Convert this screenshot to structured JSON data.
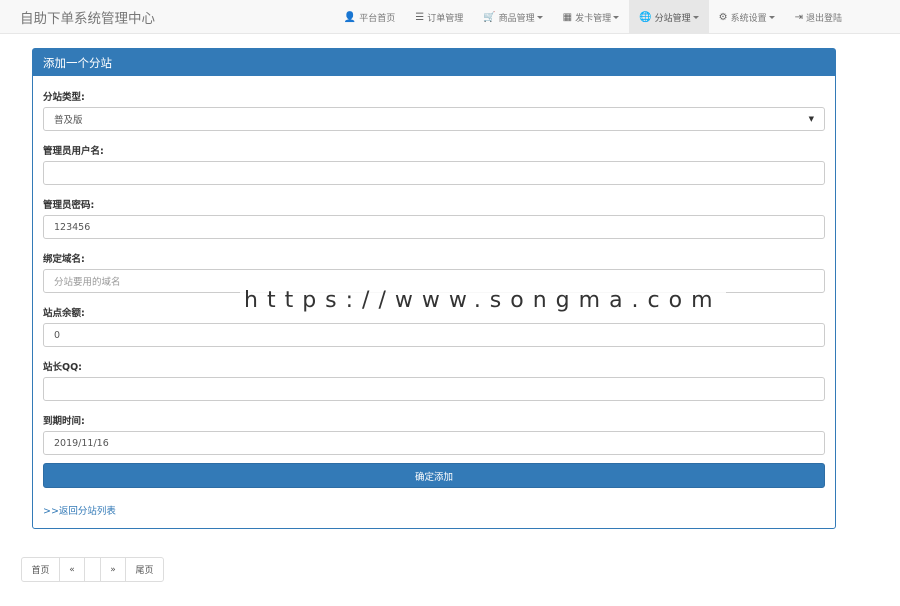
{
  "navbar": {
    "brand": "自助下单系统管理中心",
    "items": [
      {
        "label": "平台首页",
        "icon": "user-icon",
        "glyph": "👤",
        "dropdown": false,
        "active": false
      },
      {
        "label": "订单管理",
        "icon": "list-icon",
        "glyph": "☰",
        "dropdown": false,
        "active": false
      },
      {
        "label": "商品管理",
        "icon": "cart-icon",
        "glyph": "🛒",
        "dropdown": true,
        "active": false
      },
      {
        "label": "发卡管理",
        "icon": "grid-icon",
        "glyph": "▦",
        "dropdown": true,
        "active": false
      },
      {
        "label": "分站管理",
        "icon": "globe-icon",
        "glyph": "🌐",
        "dropdown": true,
        "active": true
      },
      {
        "label": "系统设置",
        "icon": "gear-icon",
        "glyph": "⚙",
        "dropdown": true,
        "active": false
      },
      {
        "label": "退出登陆",
        "icon": "logout-icon",
        "glyph": "⇥",
        "dropdown": false,
        "active": false
      }
    ]
  },
  "panel": {
    "title": "添加一个分站",
    "fields": {
      "type": {
        "label": "分站类型:",
        "value": "普及版"
      },
      "admin_user": {
        "label": "管理员用户名:",
        "value": ""
      },
      "admin_pass": {
        "label": "管理员密码:",
        "value": "123456"
      },
      "domain": {
        "label": "绑定域名:",
        "placeholder": "分站要用的域名"
      },
      "balance": {
        "label": "站点余额:",
        "value": "0"
      },
      "qq": {
        "label": "站长QQ:",
        "value": ""
      },
      "expire": {
        "label": "到期时间:",
        "value": "2019/11/16"
      }
    },
    "submit_label": "确定添加",
    "back_link": ">>返回分站列表"
  },
  "watermark": "https://www.songma.com",
  "pagination": {
    "first": "首页",
    "prev": "«",
    "current": "",
    "next": "»",
    "last": "尾页"
  }
}
